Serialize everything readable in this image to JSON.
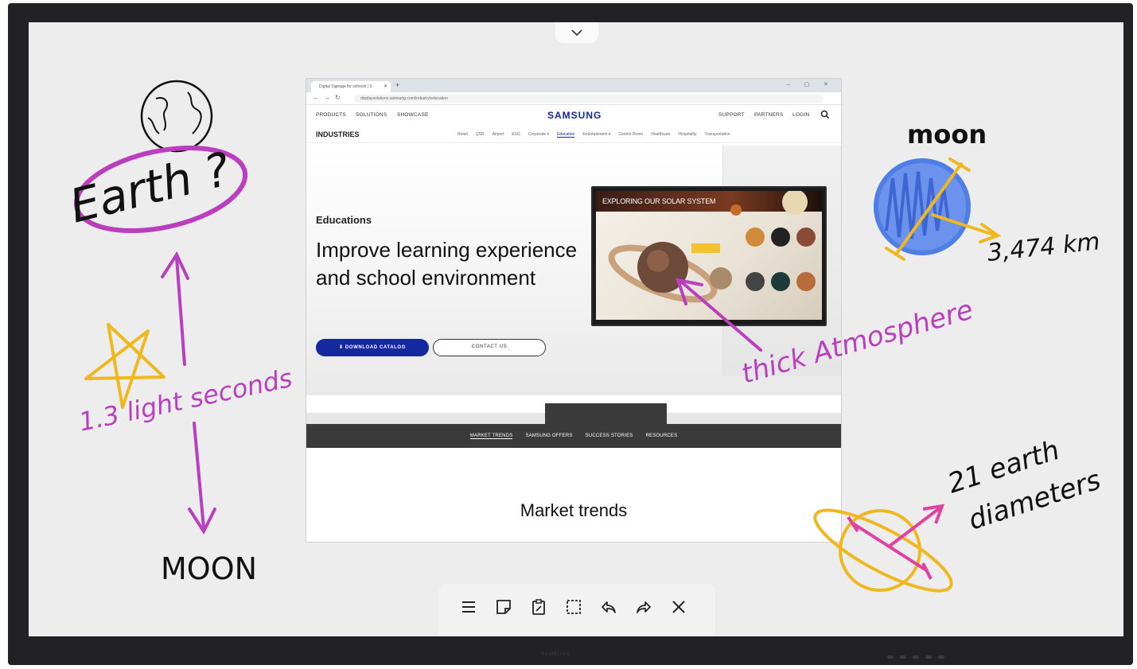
{
  "browser": {
    "tab_title": "Digital Signage for schools | S",
    "url": "displaysolutions.samsung.com/industry/education",
    "window_controls": "–  ▢  ✕"
  },
  "site": {
    "brand": "SAMSUNG",
    "nav_left": [
      "PRODUCTS",
      "SOLUTIONS",
      "SHOWCASE"
    ],
    "nav_right": [
      "SUPPORT",
      "PARTNERS",
      "LOGIN"
    ],
    "industries_title": "INDUSTRIES",
    "industry_links": [
      "Retail",
      "QSR",
      "Airport",
      "ESG",
      "Corporate ▾",
      "Education",
      "Entertainment ▾",
      "Control Room",
      "Healthcare",
      "Hospitality",
      "Transportation"
    ],
    "active_industry_index": 5
  },
  "hero": {
    "eyebrow": "Educations",
    "title": "Improve learning experience and school environment",
    "primary_button": "DOWNLOAD CATALOG",
    "secondary_button": "CONTACT US"
  },
  "display": {
    "title": "EXPLORING OUR SOLAR SYSTEM"
  },
  "sub_nav": [
    "MARKET TRENDS",
    "SAMSUNG OFFERS",
    "SUCCESS STORIES",
    "RESOURCES"
  ],
  "section_title": "Market trends",
  "annotations": {
    "earth": "Earth ?",
    "light_seconds": "1.3 light seconds",
    "moon_caps": "MOON",
    "moon_label": "moon",
    "moon_size": "3,474 km",
    "atmosphere": "thick Atmosphere",
    "diameters_line1": "21 earth",
    "diameters_line2": "diameters"
  },
  "colors": {
    "purple": "#b93fbf",
    "yellow": "#f0b820",
    "blue": "#4f7fe6",
    "pink": "#e040a0",
    "ink": "#111111"
  },
  "toolbar": [
    "menu-icon",
    "sticky-note-icon",
    "paste-icon",
    "select-area-icon",
    "undo-icon",
    "redo-icon",
    "close-icon"
  ],
  "device": {
    "brand": "SAMSUNG"
  }
}
